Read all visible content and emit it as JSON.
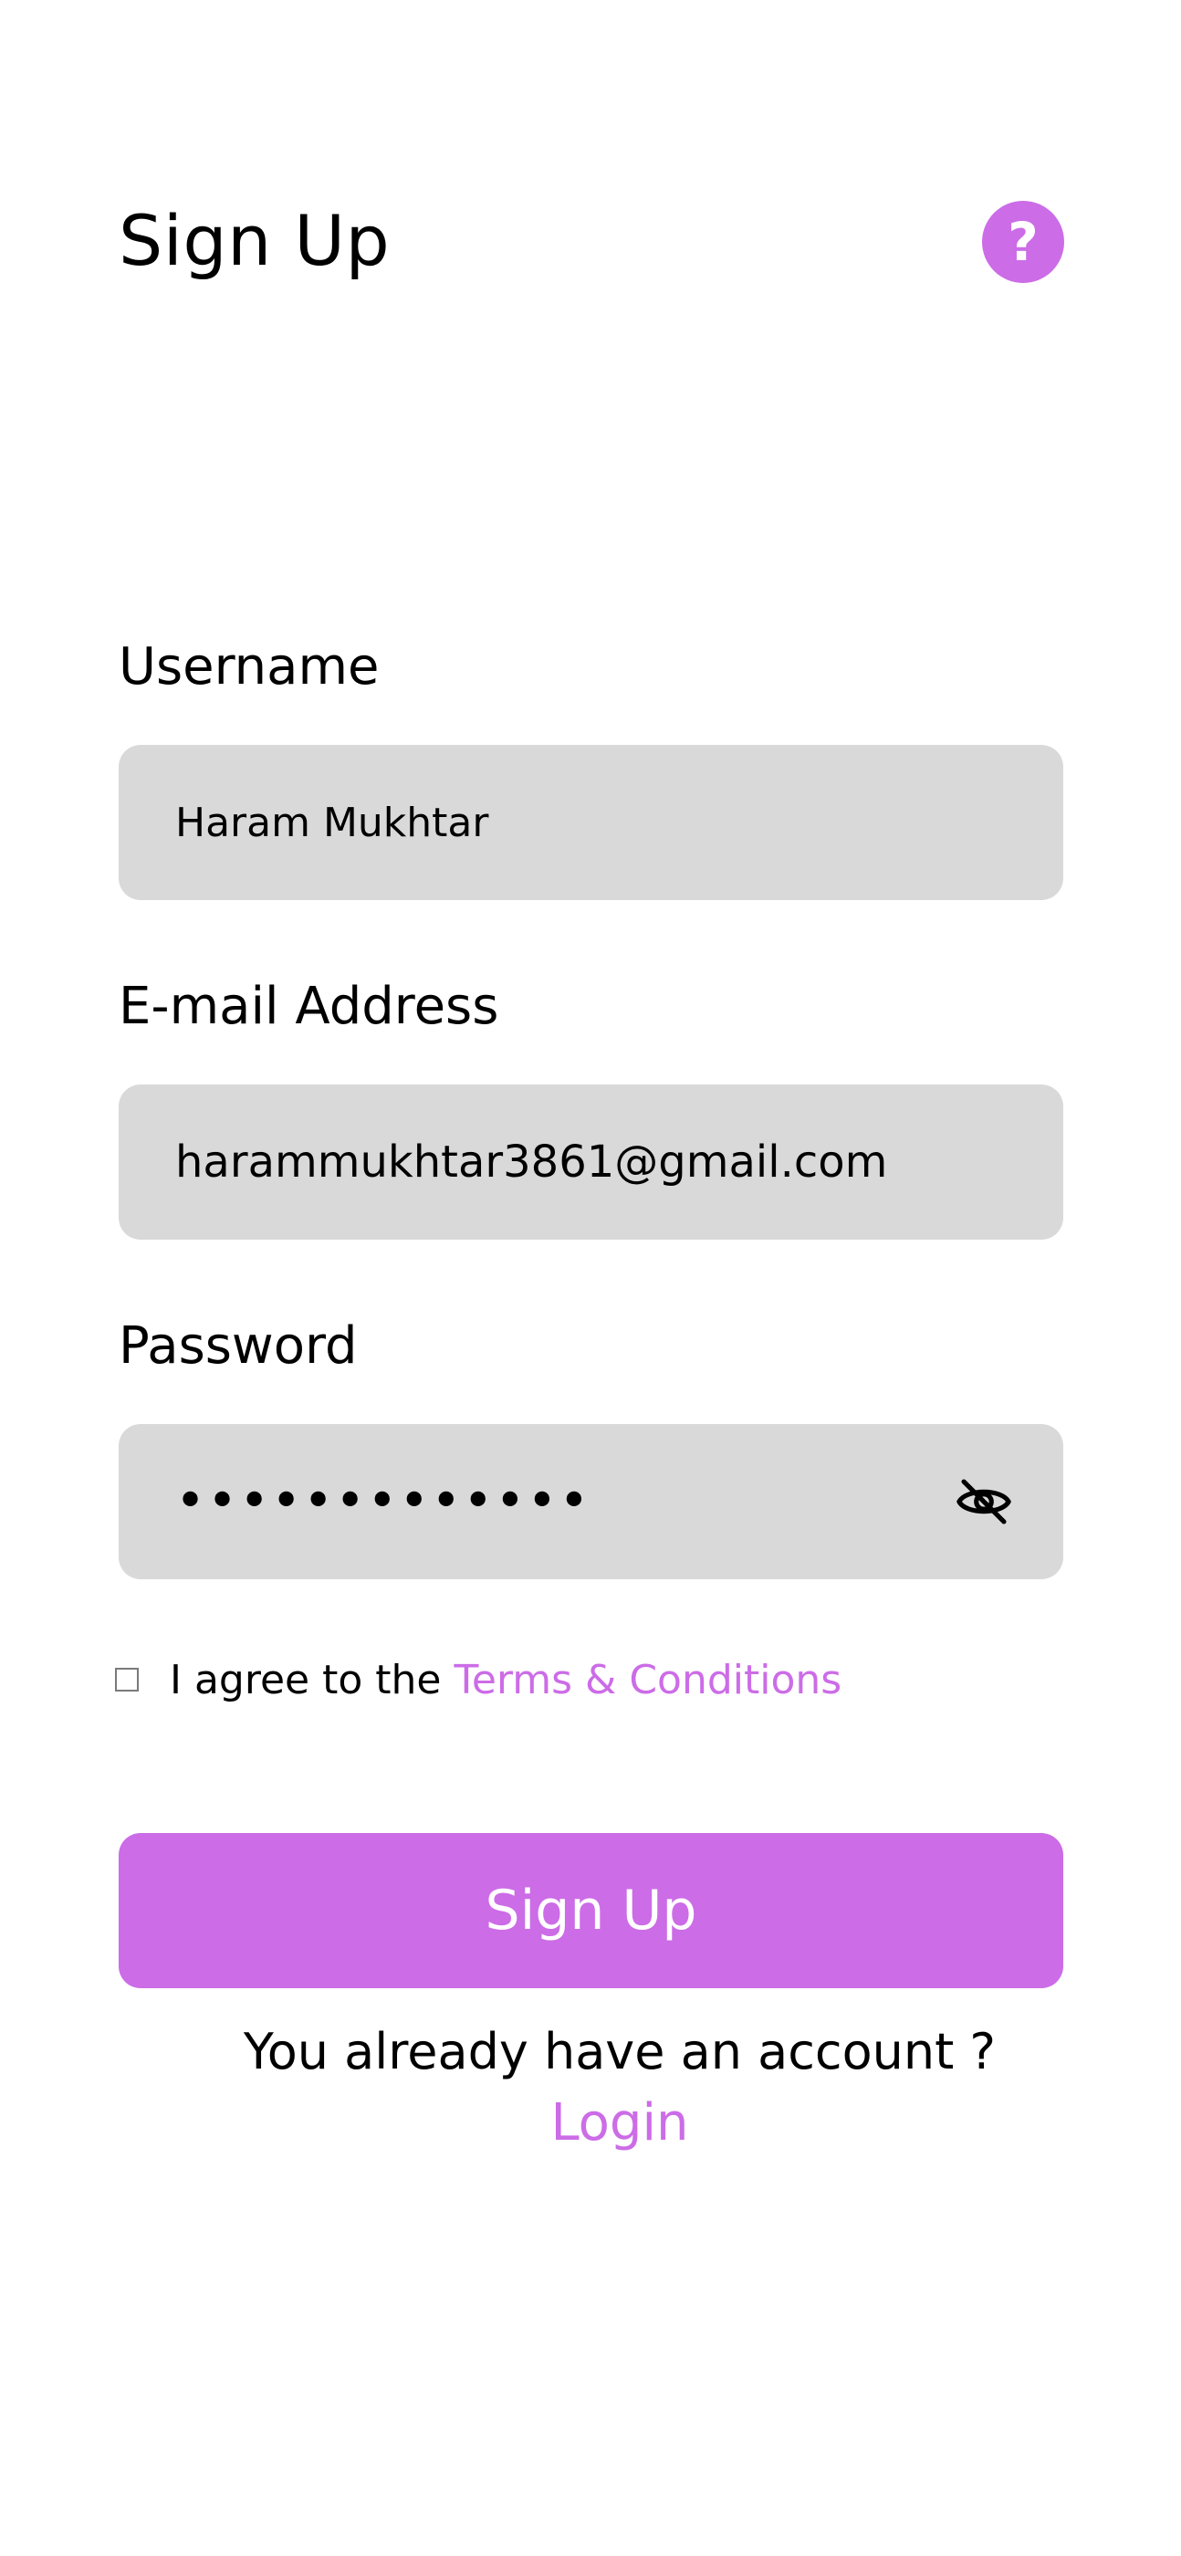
{
  "header": {
    "title": "Sign Up",
    "help_label": "?"
  },
  "form": {
    "username": {
      "label": "Username",
      "value": "Haram Mukhtar"
    },
    "email": {
      "label": "E-mail Address",
      "value": "harammukhtar3861@gmail.com"
    },
    "password": {
      "label": "Password",
      "masked_value": "•••••••••••••",
      "visibility_icon": "eye-off-icon"
    },
    "terms": {
      "checked": false,
      "prefix": "I agree to the ",
      "link": "Terms & Conditions"
    },
    "submit_label": "Sign Up"
  },
  "footer": {
    "prompt": "You already have an account ?",
    "login_label": "Login"
  },
  "colors": {
    "accent": "#cc6ce7",
    "input_bg": "#d9d9d9",
    "text": "#000000",
    "background": "#ffffff"
  }
}
